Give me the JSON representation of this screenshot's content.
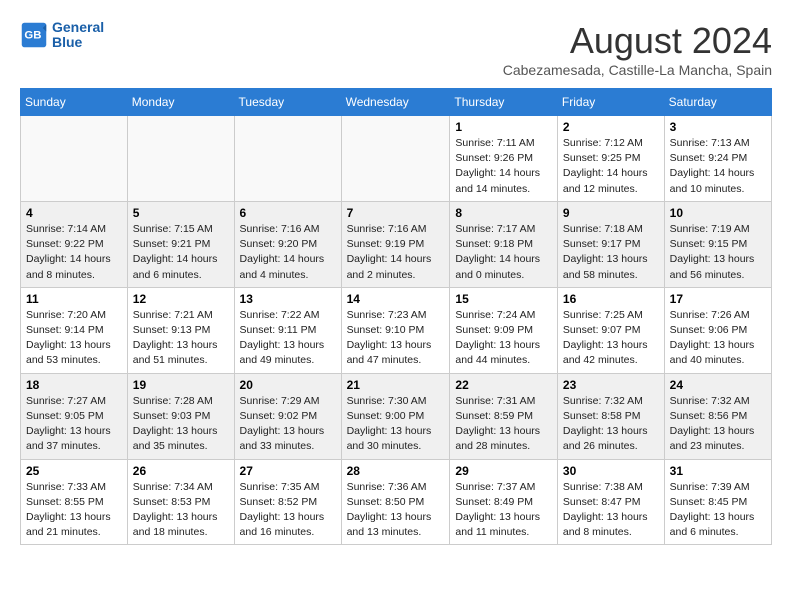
{
  "logo": {
    "line1": "General",
    "line2": "Blue"
  },
  "title": "August 2024",
  "location": "Cabezamesada, Castille-La Mancha, Spain",
  "headers": [
    "Sunday",
    "Monday",
    "Tuesday",
    "Wednesday",
    "Thursday",
    "Friday",
    "Saturday"
  ],
  "weeks": [
    [
      {
        "day": "",
        "info": ""
      },
      {
        "day": "",
        "info": ""
      },
      {
        "day": "",
        "info": ""
      },
      {
        "day": "",
        "info": ""
      },
      {
        "day": "1",
        "info": "Sunrise: 7:11 AM\nSunset: 9:26 PM\nDaylight: 14 hours\nand 14 minutes."
      },
      {
        "day": "2",
        "info": "Sunrise: 7:12 AM\nSunset: 9:25 PM\nDaylight: 14 hours\nand 12 minutes."
      },
      {
        "day": "3",
        "info": "Sunrise: 7:13 AM\nSunset: 9:24 PM\nDaylight: 14 hours\nand 10 minutes."
      }
    ],
    [
      {
        "day": "4",
        "info": "Sunrise: 7:14 AM\nSunset: 9:22 PM\nDaylight: 14 hours\nand 8 minutes."
      },
      {
        "day": "5",
        "info": "Sunrise: 7:15 AM\nSunset: 9:21 PM\nDaylight: 14 hours\nand 6 minutes."
      },
      {
        "day": "6",
        "info": "Sunrise: 7:16 AM\nSunset: 9:20 PM\nDaylight: 14 hours\nand 4 minutes."
      },
      {
        "day": "7",
        "info": "Sunrise: 7:16 AM\nSunset: 9:19 PM\nDaylight: 14 hours\nand 2 minutes."
      },
      {
        "day": "8",
        "info": "Sunrise: 7:17 AM\nSunset: 9:18 PM\nDaylight: 14 hours\nand 0 minutes."
      },
      {
        "day": "9",
        "info": "Sunrise: 7:18 AM\nSunset: 9:17 PM\nDaylight: 13 hours\nand 58 minutes."
      },
      {
        "day": "10",
        "info": "Sunrise: 7:19 AM\nSunset: 9:15 PM\nDaylight: 13 hours\nand 56 minutes."
      }
    ],
    [
      {
        "day": "11",
        "info": "Sunrise: 7:20 AM\nSunset: 9:14 PM\nDaylight: 13 hours\nand 53 minutes."
      },
      {
        "day": "12",
        "info": "Sunrise: 7:21 AM\nSunset: 9:13 PM\nDaylight: 13 hours\nand 51 minutes."
      },
      {
        "day": "13",
        "info": "Sunrise: 7:22 AM\nSunset: 9:11 PM\nDaylight: 13 hours\nand 49 minutes."
      },
      {
        "day": "14",
        "info": "Sunrise: 7:23 AM\nSunset: 9:10 PM\nDaylight: 13 hours\nand 47 minutes."
      },
      {
        "day": "15",
        "info": "Sunrise: 7:24 AM\nSunset: 9:09 PM\nDaylight: 13 hours\nand 44 minutes."
      },
      {
        "day": "16",
        "info": "Sunrise: 7:25 AM\nSunset: 9:07 PM\nDaylight: 13 hours\nand 42 minutes."
      },
      {
        "day": "17",
        "info": "Sunrise: 7:26 AM\nSunset: 9:06 PM\nDaylight: 13 hours\nand 40 minutes."
      }
    ],
    [
      {
        "day": "18",
        "info": "Sunrise: 7:27 AM\nSunset: 9:05 PM\nDaylight: 13 hours\nand 37 minutes."
      },
      {
        "day": "19",
        "info": "Sunrise: 7:28 AM\nSunset: 9:03 PM\nDaylight: 13 hours\nand 35 minutes."
      },
      {
        "day": "20",
        "info": "Sunrise: 7:29 AM\nSunset: 9:02 PM\nDaylight: 13 hours\nand 33 minutes."
      },
      {
        "day": "21",
        "info": "Sunrise: 7:30 AM\nSunset: 9:00 PM\nDaylight: 13 hours\nand 30 minutes."
      },
      {
        "day": "22",
        "info": "Sunrise: 7:31 AM\nSunset: 8:59 PM\nDaylight: 13 hours\nand 28 minutes."
      },
      {
        "day": "23",
        "info": "Sunrise: 7:32 AM\nSunset: 8:58 PM\nDaylight: 13 hours\nand 26 minutes."
      },
      {
        "day": "24",
        "info": "Sunrise: 7:32 AM\nSunset: 8:56 PM\nDaylight: 13 hours\nand 23 minutes."
      }
    ],
    [
      {
        "day": "25",
        "info": "Sunrise: 7:33 AM\nSunset: 8:55 PM\nDaylight: 13 hours\nand 21 minutes."
      },
      {
        "day": "26",
        "info": "Sunrise: 7:34 AM\nSunset: 8:53 PM\nDaylight: 13 hours\nand 18 minutes."
      },
      {
        "day": "27",
        "info": "Sunrise: 7:35 AM\nSunset: 8:52 PM\nDaylight: 13 hours\nand 16 minutes."
      },
      {
        "day": "28",
        "info": "Sunrise: 7:36 AM\nSunset: 8:50 PM\nDaylight: 13 hours\nand 13 minutes."
      },
      {
        "day": "29",
        "info": "Sunrise: 7:37 AM\nSunset: 8:49 PM\nDaylight: 13 hours\nand 11 minutes."
      },
      {
        "day": "30",
        "info": "Sunrise: 7:38 AM\nSunset: 8:47 PM\nDaylight: 13 hours\nand 8 minutes."
      },
      {
        "day": "31",
        "info": "Sunrise: 7:39 AM\nSunset: 8:45 PM\nDaylight: 13 hours\nand 6 minutes."
      }
    ]
  ]
}
